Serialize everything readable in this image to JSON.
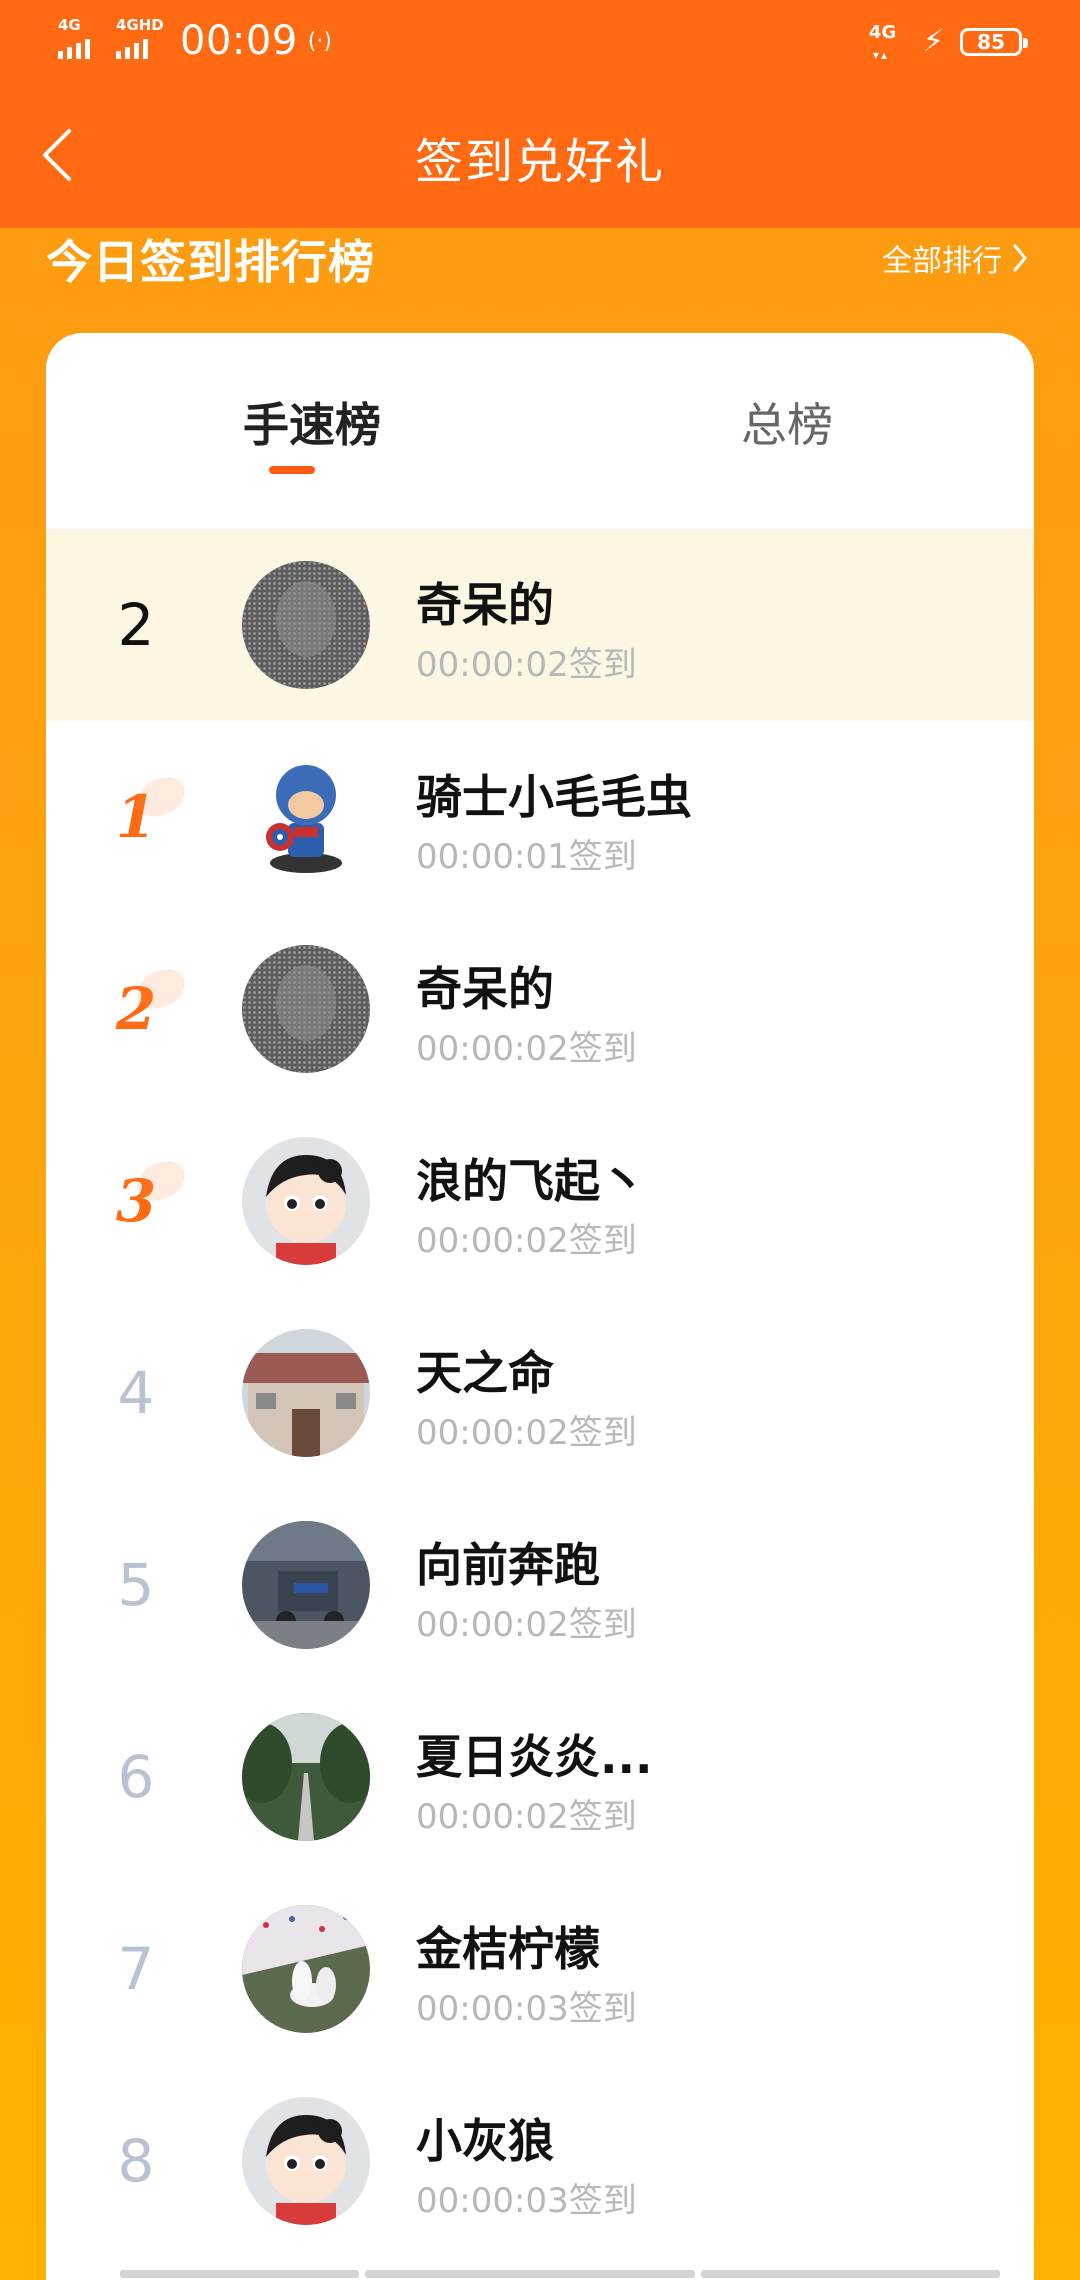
{
  "status_bar": {
    "sim1": "4G",
    "sim2": "4GHD",
    "time": "00:09",
    "net_right": "4G",
    "battery": "85"
  },
  "nav": {
    "title": "签到兑好礼"
  },
  "ranking": {
    "title": "今日签到排行榜",
    "all_label": "全部排行",
    "tabs": [
      "手速榜",
      "总榜"
    ],
    "my_row": {
      "rank": "2",
      "name": "奇呆的",
      "time": "00:00:02签到"
    },
    "rows": [
      {
        "rank": "1",
        "name": "骑士小毛毛虫",
        "time": "00:00:01签到"
      },
      {
        "rank": "2",
        "name": "奇呆的",
        "time": "00:00:02签到"
      },
      {
        "rank": "3",
        "name": "浪的飞起丶",
        "time": "00:00:02签到"
      },
      {
        "rank": "4",
        "name": "天之命",
        "time": "00:00:02签到"
      },
      {
        "rank": "5",
        "name": "向前奔跑",
        "time": "00:00:02签到"
      },
      {
        "rank": "6",
        "name": "夏日炎炎...",
        "time": "00:00:02签到"
      },
      {
        "rank": "7",
        "name": "金桔柠檬",
        "time": "00:00:03签到"
      },
      {
        "rank": "8",
        "name": "小灰狼",
        "time": "00:00:03签到"
      }
    ]
  },
  "colors": {
    "header": "#ff6a12",
    "accent": "#ff5a16",
    "highlight_row": "#fdf6e3",
    "rank_gray": "#b9c2d2"
  }
}
